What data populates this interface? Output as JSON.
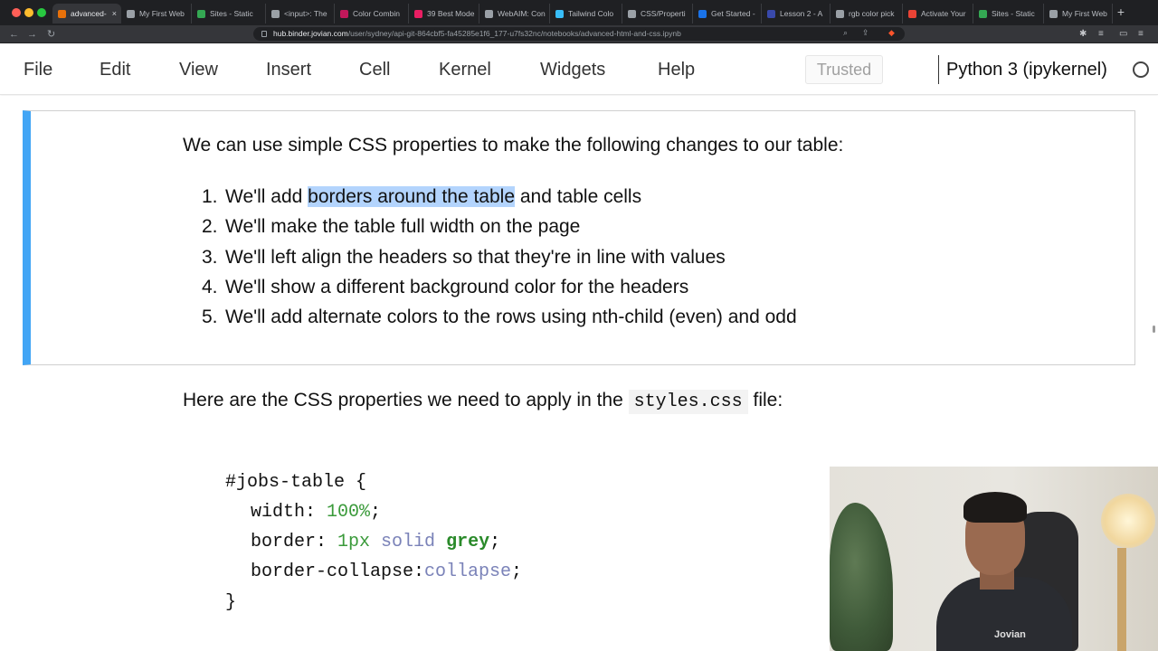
{
  "browser": {
    "tabs": [
      {
        "label": "advanced-",
        "active": true,
        "color": "#e8710a"
      },
      {
        "label": "My First Web",
        "color": "#9aa0a6"
      },
      {
        "label": "Sites - Static",
        "color": "#34a853"
      },
      {
        "label": "<input>: The",
        "color": "#9aa0a6"
      },
      {
        "label": "Color Combin",
        "color": "#c2185b"
      },
      {
        "label": "39 Best Mode",
        "color": "#e91e63"
      },
      {
        "label": "WebAIM: Con",
        "color": "#9aa0a6"
      },
      {
        "label": "Tailwind Colo",
        "color": "#38bdf8"
      },
      {
        "label": "CSS/Properti",
        "color": "#9aa0a6"
      },
      {
        "label": "Get Started -",
        "color": "#1a73e8"
      },
      {
        "label": "Lesson 2 - A",
        "color": "#3949ab"
      },
      {
        "label": "rgb color pick",
        "color": "#9aa0a6"
      },
      {
        "label": "Activate Your",
        "color": "#ea4335"
      },
      {
        "label": "Sites - Static",
        "color": "#34a853"
      },
      {
        "label": "My First Web",
        "color": "#9aa0a6"
      }
    ],
    "tab_close": "×",
    "new_tab": "+",
    "url_host": "hub.binder.jovian.com",
    "url_path": "/user/sydney/api-git-864cbf5-fa45285e1f6_177-u7fs32nc/notebooks/advanced-html-and-css.ipynb",
    "nav_back": "←",
    "nav_forward": "→",
    "nav_reload": "↻"
  },
  "menubar": {
    "items": [
      "File",
      "Edit",
      "View",
      "Insert",
      "Cell",
      "Kernel",
      "Widgets",
      "Help"
    ],
    "trusted": "Trusted",
    "kernel": "Python 3 (ipykernel)"
  },
  "cell1": {
    "intro": "We can use simple CSS properties to make the following changes to our table:",
    "list": [
      {
        "num": "1.",
        "pre": "We'll add ",
        "highlight": "borders around the table",
        "post": " and table cells"
      },
      {
        "num": "2.",
        "text": "We'll make the table full width on the page"
      },
      {
        "num": "3.",
        "text": "We'll left align the headers so that they're in line with values"
      },
      {
        "num": "4.",
        "text": "We'll show a different background color for the headers"
      },
      {
        "num": "5.",
        "text": "We'll add alternate colors to the rows using nth-child (even) and odd"
      }
    ]
  },
  "cell2": {
    "pre": "Here are the CSS properties we need to apply in the ",
    "code": "styles.css",
    "post": " file:"
  },
  "css_code": {
    "selector": "#jobs-table",
    "open": " {",
    "line1_prop": "width: ",
    "line1_val": "100%",
    "line1_end": ";",
    "line2_prop": "border: ",
    "line2_v1": "1px",
    "line2_v2": "solid",
    "line2_v3": "grey",
    "line2_end": ";",
    "line3_prop": "border-collapse:",
    "line3_val": "collapse",
    "line3_end": ";",
    "close": "}"
  },
  "webcam": {
    "logo": "Jovian"
  },
  "colors": {
    "cell_accent": "#42a5f5",
    "highlight": "#b3d4fd",
    "code_number": "#3a9a3a",
    "code_keyword": "#7a82b8",
    "code_string": "#2a8a2a"
  }
}
